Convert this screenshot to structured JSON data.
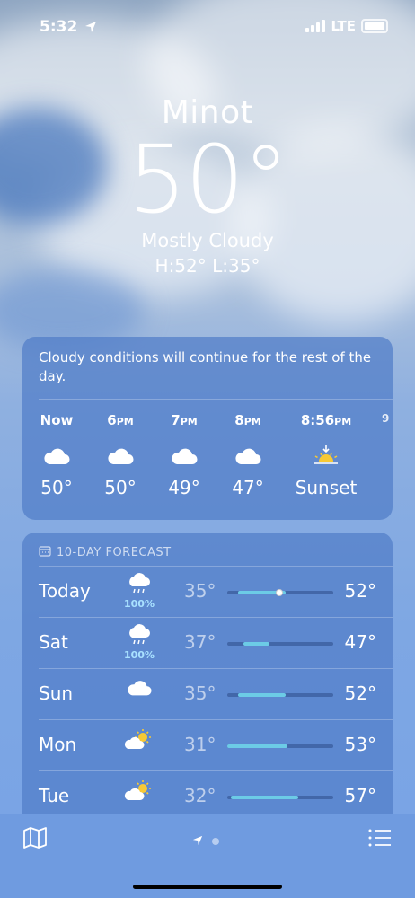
{
  "status_bar": {
    "time": "5:32",
    "network": "LTE"
  },
  "location": {
    "city": "Minot",
    "temperature": "50°",
    "condition": "Mostly Cloudy",
    "high_low": "H:52°  L:35°"
  },
  "hourly": {
    "summary": "Cloudy conditions will continue for the rest of the day.",
    "items": [
      {
        "time": "Now",
        "suffix": "",
        "icon": "cloud-icon",
        "value": "50°"
      },
      {
        "time": "6",
        "suffix": "PM",
        "icon": "cloud-icon",
        "value": "50°"
      },
      {
        "time": "7",
        "suffix": "PM",
        "icon": "cloud-icon",
        "value": "49°"
      },
      {
        "time": "8",
        "suffix": "PM",
        "icon": "cloud-icon",
        "value": "47°"
      },
      {
        "time": "8:56",
        "suffix": "PM",
        "icon": "sunset-icon",
        "value": "Sunset"
      }
    ]
  },
  "daily": {
    "header": "10-DAY FORECAST",
    "days": [
      {
        "name": "Today",
        "icon": "cloud-rain-icon",
        "precip": "100%",
        "low": "35°",
        "high": "52°",
        "range": [
          0.1,
          0.55
        ],
        "current": 0.48
      },
      {
        "name": "Sat",
        "icon": "cloud-rain-icon",
        "precip": "100%",
        "low": "37°",
        "high": "47°",
        "range": [
          0.15,
          0.4
        ]
      },
      {
        "name": "Sun",
        "icon": "cloud-icon",
        "precip": "",
        "low": "35°",
        "high": "52°",
        "range": [
          0.1,
          0.55
        ]
      },
      {
        "name": "Mon",
        "icon": "partly-sunny-icon",
        "precip": "",
        "low": "31°",
        "high": "53°",
        "range": [
          0.0,
          0.57
        ]
      },
      {
        "name": "Tue",
        "icon": "partly-sunny-icon",
        "precip": "",
        "low": "32°",
        "high": "57°",
        "range": [
          0.03,
          0.67
        ]
      }
    ]
  },
  "colors": {
    "range_fill": "#6ccbe6",
    "precip_text": "#a9e1ff"
  }
}
